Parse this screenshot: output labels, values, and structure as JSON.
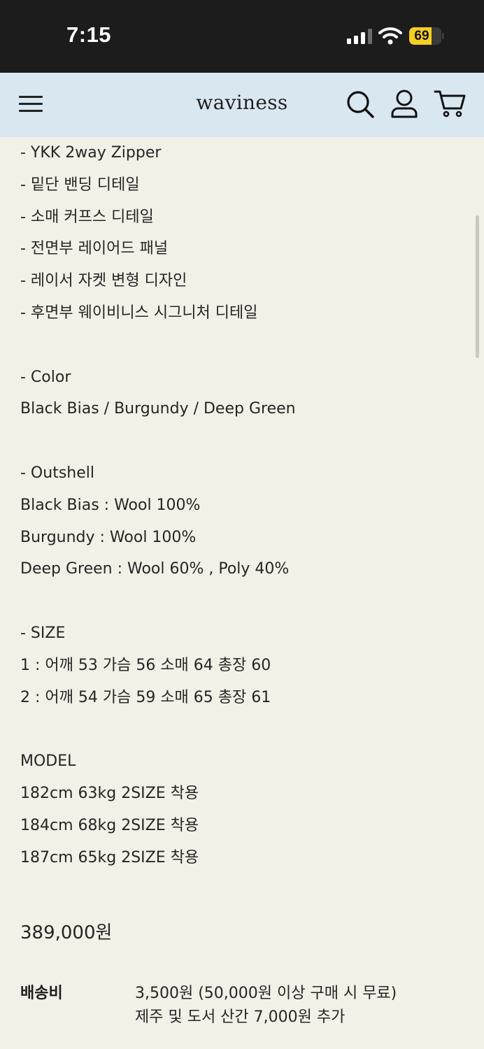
{
  "status_bar": {
    "time": "7:15",
    "battery_percent": 69,
    "battery_label": "69",
    "battery_color": "#f5d020",
    "icons": [
      "signal-icon",
      "wifi-icon",
      "battery-icon"
    ]
  },
  "header": {
    "brand": "waviness",
    "background": "#d8e7f0",
    "icons": [
      "menu-icon",
      "search-icon",
      "user-icon",
      "cart-icon"
    ]
  },
  "details": {
    "features": [
      "- YKK 2way Zipper",
      "- 밑단 밴딩 디테일",
      "- 소매 커프스 디테일",
      "- 전면부 레이어드 패널",
      "- 레이서 자켓 변형 디자인",
      "- 후면부 웨이비니스 시그니처 디테일"
    ],
    "color_heading": "- Color",
    "color_value": "Black Bias / Burgundy / Deep Green",
    "outshell_heading": "- Outshell",
    "outshell": [
      "Black Bias : Wool 100%",
      "Burgundy : Wool 100%",
      "Deep Green : Wool 60% , Poly 40%"
    ],
    "size_heading": "- SIZE",
    "sizes": [
      "1 : 어깨 53 가슴 56 소매 64 총장 60",
      "2 : 어깨 54 가슴 59 소매 65 총장 61"
    ],
    "model_heading": "MODEL",
    "models": [
      "182cm 63kg 2SIZE 착용",
      "184cm 68kg 2SIZE 착용",
      "187cm 65kg 2SIZE 착용"
    ]
  },
  "price": "389,000원",
  "shipping": {
    "label": "배송비",
    "line1": "3,500원 (50,000원 이상 구매 시 무료)",
    "line2": "제주 및 도서 산간 7,000원 추가"
  }
}
